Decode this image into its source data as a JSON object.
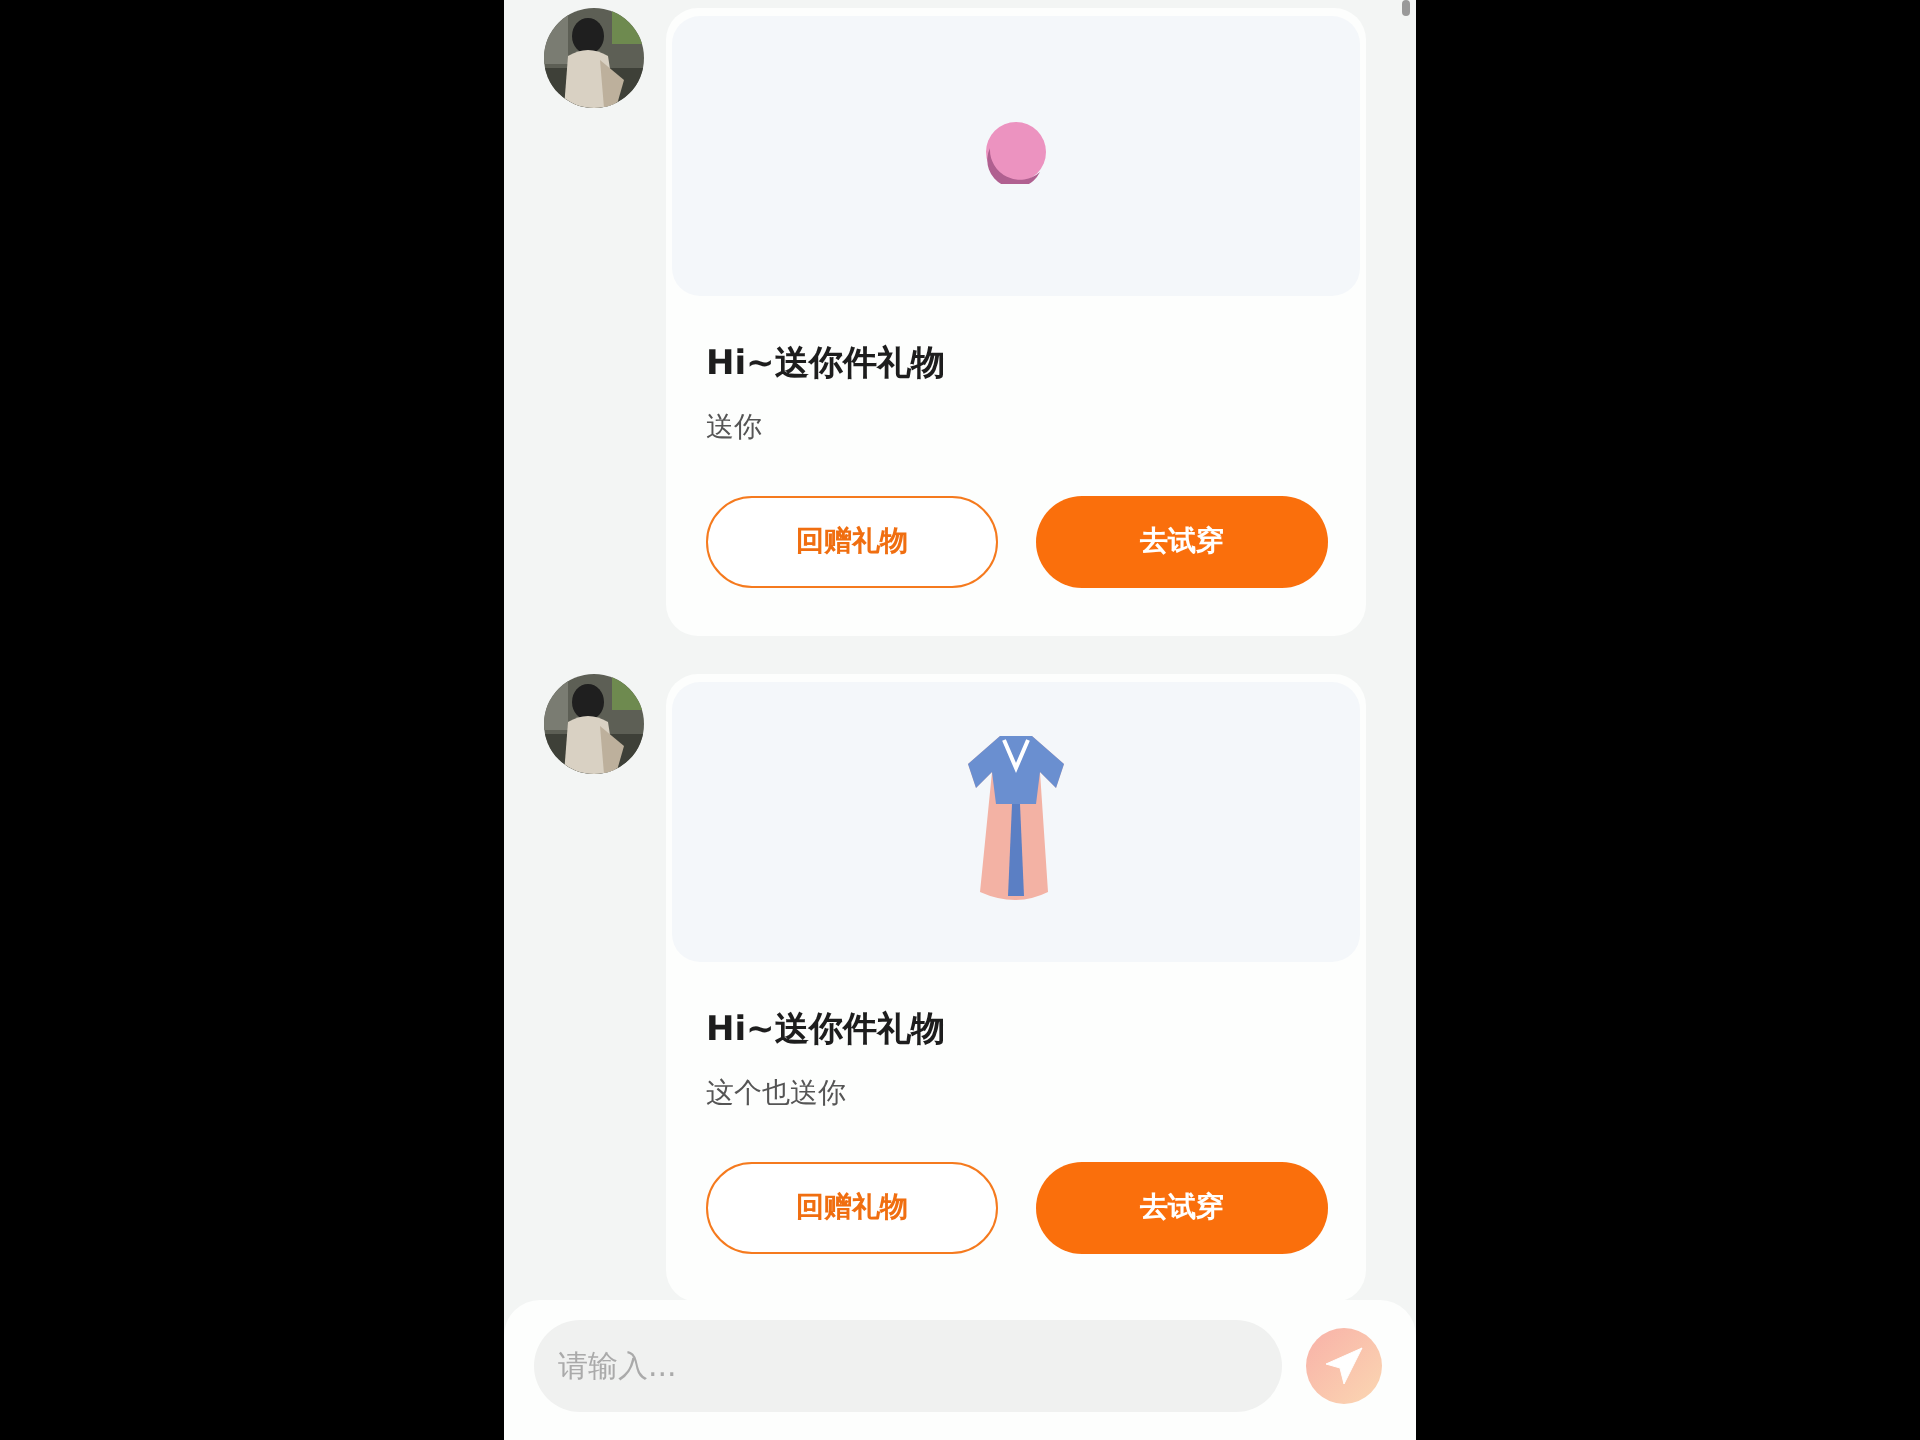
{
  "messages": [
    {
      "gift": {
        "kind": "ball"
      },
      "title": "Hi~送你件礼物",
      "note": "送你",
      "buttons": [
        {
          "kind": "outline",
          "label": "回赠礼物"
        },
        {
          "kind": "filled",
          "label": "去试穿"
        }
      ]
    },
    {
      "gift": {
        "kind": "dress"
      },
      "title": "Hi~送你件礼物",
      "note": "这个也送你",
      "buttons": [
        {
          "kind": "outline",
          "label": "回赠礼物"
        },
        {
          "kind": "filled",
          "label": "去试穿"
        }
      ]
    }
  ],
  "composer": {
    "placeholder": "请输入...",
    "send_disabled": true
  }
}
